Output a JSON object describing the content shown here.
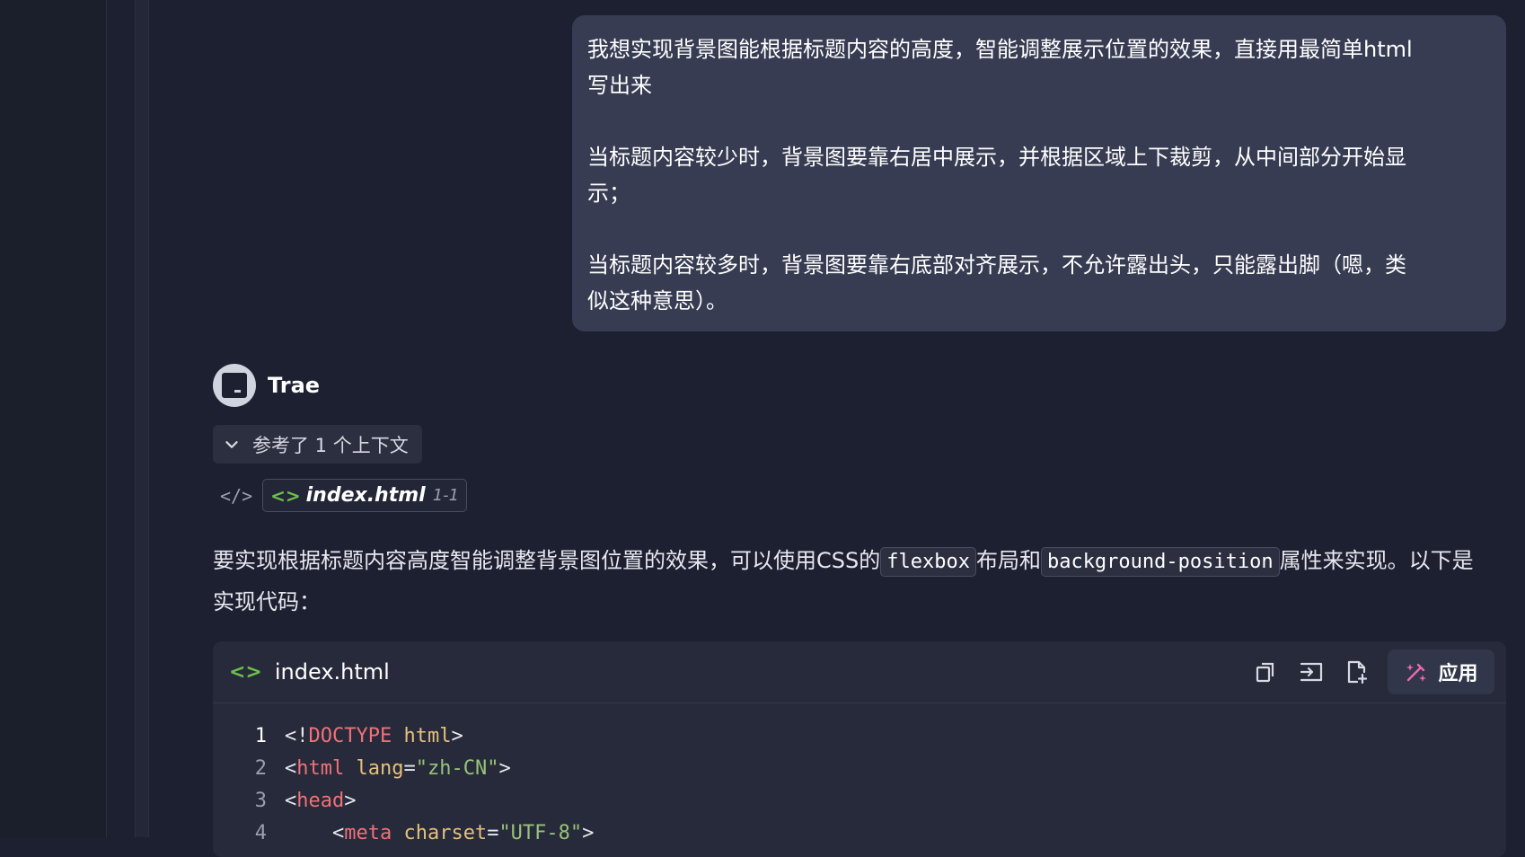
{
  "user_message": {
    "paragraphs": [
      "我想实现背景图能根据标题内容的高度，智能调整展示位置的效果，直接用最简单html\n写出来",
      "当标题内容较少时，背景图要靠右居中展示，并根据区域上下裁剪，从中间部分开始显\n示；",
      "当标题内容较多时，背景图要靠右底部对齐展示，不允许露出头，只能露出脚（嗯，类\n似这种意思）。"
    ]
  },
  "agent": {
    "name": "Trae"
  },
  "context": {
    "label": "参考了 1 个上下文",
    "file_name": "index.html",
    "line_range": "1-1",
    "code_tag": "</>"
  },
  "answer": {
    "part1": "要实现根据标题内容高度智能调整背景图位置的效果，可以使用CSS的",
    "code1": "flexbox",
    "part2": "布局和",
    "code2": "background-position",
    "part3": "属性来实现。以下是实现代码："
  },
  "code_block": {
    "file_name": "index.html",
    "apply_label": "应用",
    "lines": [
      {
        "n": "1",
        "a": "<!",
        "b": "DOCTYPE",
        "c": " html",
        "d": ">"
      },
      {
        "n": "2",
        "a": "<",
        "b": "html",
        "c": " lang",
        "d": "=",
        "e": "\"zh-CN\"",
        "f": ">"
      },
      {
        "n": "3",
        "a": "<",
        "b": "head",
        "c": ">"
      },
      {
        "n": "4",
        "a": "    <",
        "b": "meta",
        "c": " charset",
        "d": "=",
        "e": "\"UTF-8\"",
        "f": ">"
      }
    ]
  }
}
